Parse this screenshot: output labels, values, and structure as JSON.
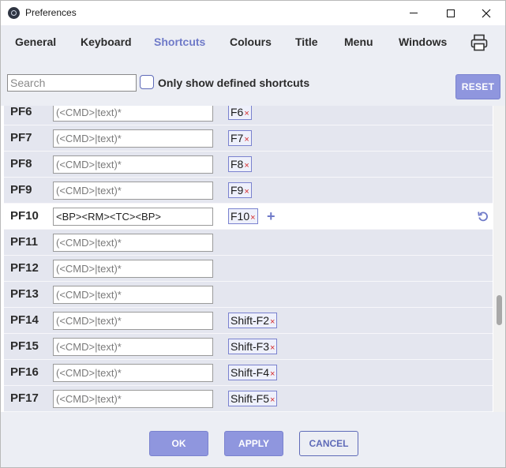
{
  "window": {
    "title": "Preferences",
    "minimize": "—",
    "maximize": "☐",
    "close": "✕"
  },
  "tabs": [
    {
      "label": "General",
      "active": false
    },
    {
      "label": "Keyboard",
      "active": false
    },
    {
      "label": "Shortcuts",
      "active": true
    },
    {
      "label": "Colours",
      "active": false
    },
    {
      "label": "Title",
      "active": false
    },
    {
      "label": "Menu",
      "active": false
    },
    {
      "label": "Windows",
      "active": false
    }
  ],
  "toolbar": {
    "search_placeholder": "Search",
    "only_defined_label": "Only show defined shortcuts",
    "reset_label": "RESET"
  },
  "command_placeholder": "(<CMD>|text)*",
  "rows": [
    {
      "key": "PF6",
      "command": "",
      "shortcut": "F6"
    },
    {
      "key": "PF7",
      "command": "",
      "shortcut": "F7"
    },
    {
      "key": "PF8",
      "command": "",
      "shortcut": "F8"
    },
    {
      "key": "PF9",
      "command": "",
      "shortcut": "F9"
    },
    {
      "key": "PF10",
      "command": "<BP><RM><TC><BP>",
      "shortcut": "F10",
      "selected": true
    },
    {
      "key": "PF11",
      "command": "",
      "shortcut": ""
    },
    {
      "key": "PF12",
      "command": "",
      "shortcut": ""
    },
    {
      "key": "PF13",
      "command": "",
      "shortcut": ""
    },
    {
      "key": "PF14",
      "command": "",
      "shortcut": "Shift-F2"
    },
    {
      "key": "PF15",
      "command": "",
      "shortcut": "Shift-F3"
    },
    {
      "key": "PF16",
      "command": "",
      "shortcut": "Shift-F4"
    },
    {
      "key": "PF17",
      "command": "",
      "shortcut": "Shift-F5"
    }
  ],
  "chip_remove": "×",
  "add_symbol": "+",
  "footer": {
    "ok_label": "OK",
    "apply_label": "APPLY",
    "cancel_label": "CANCEL"
  },
  "colors": {
    "accent": "#8f96de",
    "accent_border": "#7a82cf",
    "active_tab": "#6f7ac8",
    "remove_x": "#d52b2b"
  }
}
